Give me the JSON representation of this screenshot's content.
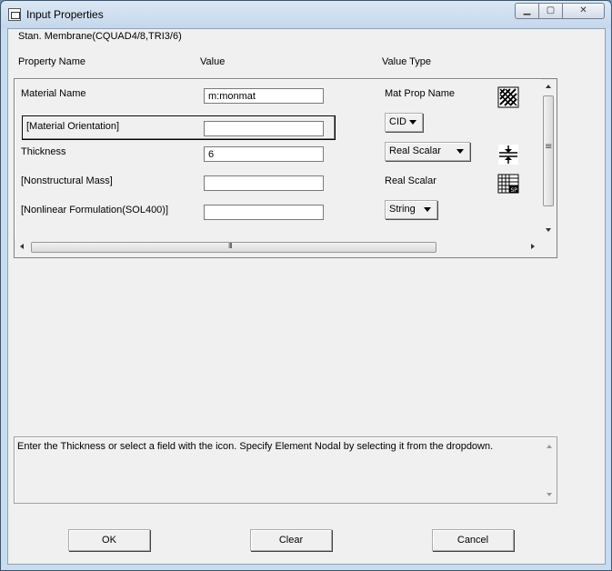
{
  "window": {
    "title": "Input Properties",
    "minimize_glyph": "▁",
    "maximize_glyph": "▢",
    "close_glyph": "✕"
  },
  "element_type": "Stan. Membrane(CQUAD4/8,TRI3/6)",
  "headers": {
    "property_name": "Property Name",
    "value": "Value",
    "value_type": "Value Type"
  },
  "rows": [
    {
      "label": "Material Name",
      "value": "m:monmat",
      "type": "Mat Prop Name",
      "type_kind": "text",
      "icon": "material-select-icon"
    },
    {
      "label": "[Material Orientation]",
      "value": "",
      "type": "CID",
      "type_kind": "dropdown",
      "icon": ""
    },
    {
      "label": "Thickness",
      "value": "6",
      "type": "Real Scalar",
      "type_kind": "dropdown",
      "icon": "thickness-field-icon"
    },
    {
      "label": "[Nonstructural Mass]",
      "value": "",
      "type": "Real Scalar",
      "type_kind": "text",
      "icon": "spreadsheet-field-icon"
    },
    {
      "label": "[Nonlinear Formulation(SOL400)]",
      "value": "",
      "type": "String",
      "type_kind": "dropdown",
      "icon": ""
    }
  ],
  "hscroll_grip": "III",
  "vscroll_grip": "≡",
  "help_text": "Enter the Thickness or select a field with the icon.  Specify Element Nodal by selecting it from the dropdown.",
  "buttons": {
    "ok": "OK",
    "clear": "Clear",
    "cancel": "Cancel"
  }
}
